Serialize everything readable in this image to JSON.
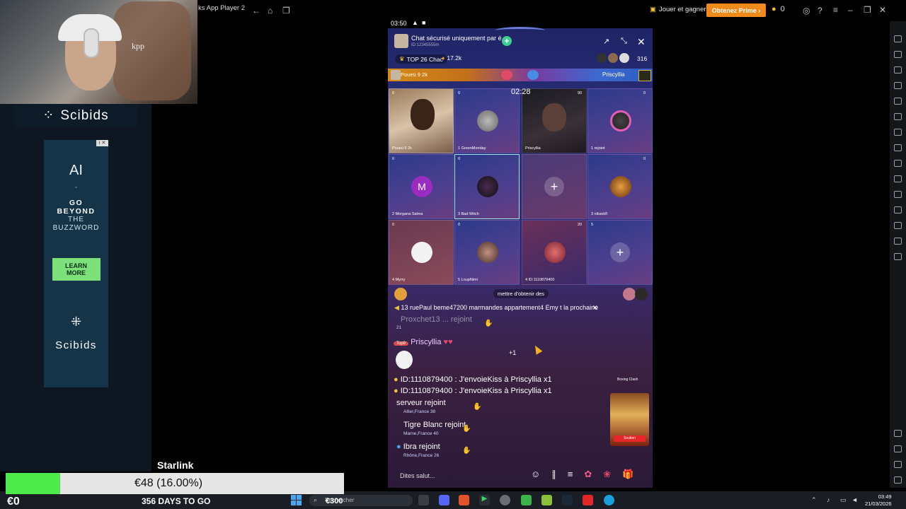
{
  "webcam": {
    "shirt_text": "kpp"
  },
  "overlay": {
    "brand": "Scibids",
    "ad": {
      "line1": "AI",
      "dash": "-",
      "go": "GO",
      "beyond": "BEYOND",
      "the": "THE",
      "buzz": "BUZZWORD",
      "cta": "LEARN MORE",
      "brand2": "Scibids"
    },
    "donation": {
      "amount": "€48 (16.00%)",
      "progress_fraction": 0.16,
      "goal_label": "€300"
    },
    "starlink": "Starlink",
    "left_total": "€0",
    "days": "356 DAYS TO GO"
  },
  "bluestacks": {
    "title": "ks App Player 2",
    "jouer": "Jouer et gagner",
    "prime": "Obtenez Prime",
    "coins": "0"
  },
  "phone": {
    "status_time": "03:50",
    "room_name": "Chat sécurisé uniquement par é",
    "room_id": "ID:12345555m",
    "top_label": "TOP 26 Chac",
    "score": "17.2k",
    "viewers": "316",
    "vs_left": "Poueü 9 2k",
    "vs_right": "Priscyllia",
    "timer": "02:28",
    "seats": [
      {
        "label": "Poueü 9 2k",
        "count": "0"
      },
      {
        "label": "1  GreenMonday",
        "count": "0"
      },
      {
        "label": "Priscyllia",
        "count": "90"
      },
      {
        "label": "1  rejoint",
        "count": "0"
      },
      {
        "label": "2  Morgana Salma",
        "count": "0",
        "letter": "M"
      },
      {
        "label": "3  Bad Witch",
        "count": "0"
      },
      {
        "label": "",
        "count": ""
      },
      {
        "label": "3  nikavkfl",
        "count": "0"
      },
      {
        "label": "4  Myrry",
        "count": "0"
      },
      {
        "label": "5  LoupNimi",
        "count": "0"
      },
      {
        "label": "4  ID:1110879400",
        "count": "20"
      },
      {
        "label": "",
        "count": "5"
      }
    ],
    "get_banner": "mettre d'obtenir des",
    "pinned": "13 ruePaul beme47200 marmandes appartement4 Emy t la prochaine",
    "chat": [
      {
        "text": "Proxchet13 ... rejoint",
        "sub": "21"
      },
      {
        "text": "Priscyllia",
        "sub": ""
      },
      {
        "text": "ID:1110879400   : J'envoieKiss à Priscyllia  x1",
        "sub": ""
      },
      {
        "text": "ID:1110879400   : J'envoieKiss à Priscyllia  x1",
        "sub": ""
      },
      {
        "text": "serveur  rejoint",
        "sub": "Allier,France   38"
      },
      {
        "text": "Tigre Blanc rejoint",
        "sub": "Marne,France   40"
      },
      {
        "text": "Ibra rejoint",
        "sub": "Rhône,France   26"
      }
    ],
    "plus_one": "+1",
    "promo_title": "Boxing Clash",
    "promo_btn": "Soutien",
    "input_placeholder": "Dites salut..."
  },
  "taskbar": {
    "search": "Rechercher",
    "time": "03:49",
    "date": "21/03/2026"
  },
  "colors": {
    "accent": "#f08a1c",
    "donation_green": "#4ee94b",
    "phone_bg": "#2a2f7a"
  }
}
